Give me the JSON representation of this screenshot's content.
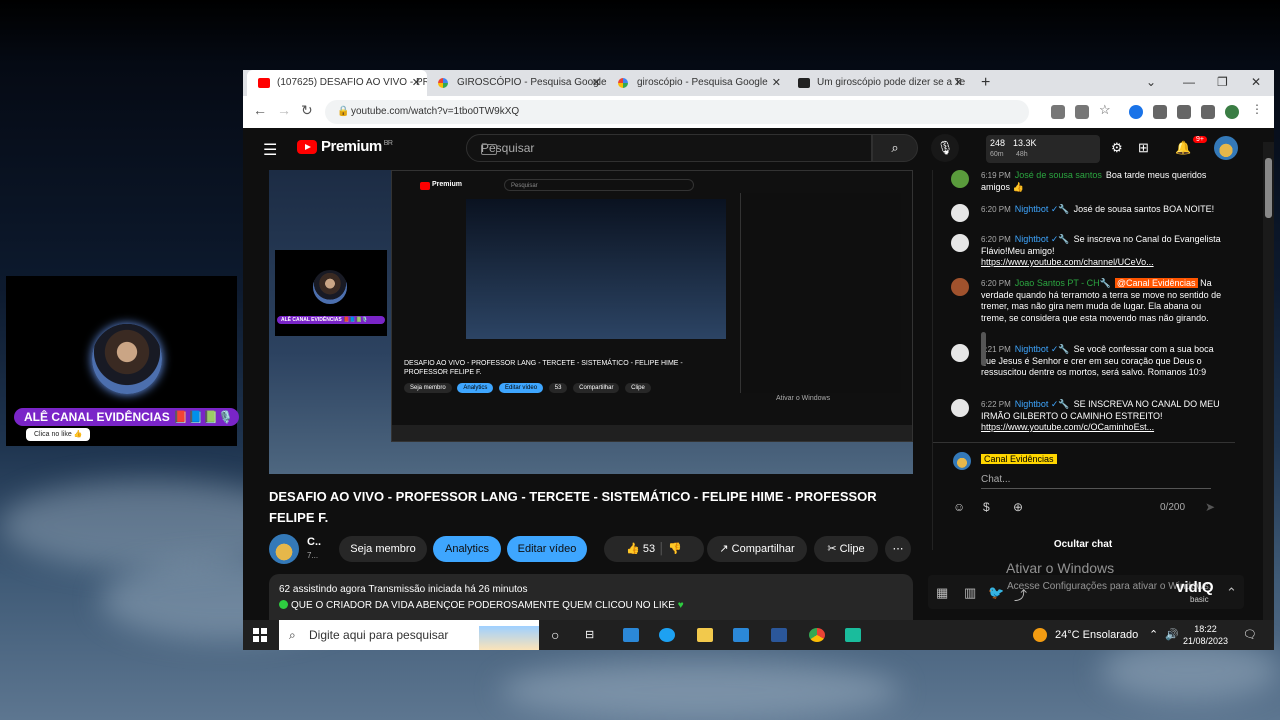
{
  "overlay": {
    "channel_name": "ALÊ CANAL EVIDÊNCIAS 📕📘📗🎙️",
    "tag": "Clica no like 👍"
  },
  "browser": {
    "tabs": [
      {
        "title": "(107625) DESAFIO AO VIVO - PR",
        "favicon": "youtube-icon",
        "active": true
      },
      {
        "title": "GIROSCÓPIO - Pesquisa Google",
        "favicon": "google-icon",
        "active": false
      },
      {
        "title": "giroscópio - Pesquisa Google",
        "favicon": "google-icon",
        "active": false
      },
      {
        "title": "Um giroscópio pode dizer se a Te",
        "favicon": "site-icon",
        "active": false
      }
    ],
    "url": "youtube.com/watch?v=1tbo0TW9kXQ"
  },
  "yt": {
    "logo_text": "Premium",
    "region": "BR",
    "search_placeholder": "Pesquisar",
    "stats": {
      "viewers": "248",
      "subs": "13.3K",
      "viewers_sub": "60m",
      "subs_sub": "48h"
    },
    "notif_badge": "9+"
  },
  "video": {
    "title": "DESAFIO AO VIVO - PROFESSOR LANG - TERCETE - SISTEMÁTICO - FELIPE HIME - PROFESSOR FELIPE F.",
    "channel_short": "C..",
    "channel_sub": "7...",
    "member_btn": "Seja membro",
    "analytics_btn": "Analytics",
    "edit_btn": "Editar vídeo",
    "likes": "53",
    "share_btn": "Compartilhar",
    "clip_btn": "Clipe",
    "desc_line1": "62 assistindo agora  Transmissão iniciada há 26 minutos",
    "desc_line2": "QUE O CRIADOR DA VIDA ABENÇOE PODEROSAMENTE QUEM CLICOU NO LIKE"
  },
  "inner": {
    "title": "DESAFIO AO VIVO - PROFESSOR LANG - TERCETE - SISTEMÁTICO - FELIPE HIME - PROFESSOR FELIPE F.",
    "buttons": [
      "Seja membro",
      "Analytics",
      "Editar vídeo",
      "53",
      "Compartilhar",
      "Clipe"
    ],
    "activate": "Ativar o Windows"
  },
  "chat": {
    "messages": [
      {
        "time": "6:19 PM",
        "author": "José de sousa santos",
        "bot": false,
        "text": "Boa tarde meus queridos amigos 👍",
        "link": ""
      },
      {
        "time": "6:20 PM",
        "author": "Nightbot ✓🔧",
        "bot": true,
        "text": "José de sousa santos BOA NOITE!",
        "link": ""
      },
      {
        "time": "6:20 PM",
        "author": "Nightbot ✓🔧",
        "bot": true,
        "text": "Se inscreva no Canal do Evangelista Flávio!Meu amigo!",
        "link": "https://www.youtube.com/channel/UCeVo..."
      },
      {
        "time": "6:20 PM",
        "author": "Joao Santos PT - CH🔧",
        "bot": false,
        "tag": "@Canal Evidências",
        "text": "Na verdade quando há terramoto a terra se move no sentido de tremer, mas não gira nem muda de lugar. Ela abana ou treme, se considera que esta movendo mas não girando.",
        "link": ""
      },
      {
        "time": "6:21 PM",
        "author": "Nightbot ✓🔧",
        "bot": true,
        "text": "Se você confessar com a sua boca que Jesus é Senhor e crer em seu coração que Deus o ressuscitou dentre os mortos, será salvo. Romanos 10:9",
        "link": ""
      },
      {
        "time": "6:22 PM",
        "author": "Nightbot ✓🔧",
        "bot": true,
        "text": "SE INSCREVA NO CANAL DO MEU IRMÃO GILBERTO O CAMINHO ESTREITO!",
        "link": "https://www.youtube.com/c/OCaminhoEst..."
      }
    ],
    "input_name": "Canal Evidências",
    "input_placeholder": "Chat...",
    "counter": "0/200",
    "hide_label": "Ocultar chat"
  },
  "watermark": {
    "line1": "Ativar o Windows",
    "line2": "Acesse Configurações para ativar o Windows."
  },
  "vidiq": {
    "label": "vidIQ",
    "plan": "basic"
  },
  "taskbar": {
    "search_placeholder": "Digite aqui para pesquisar",
    "weather": "24°C  Ensolarado",
    "time": "18:22",
    "date": "21/08/2023"
  },
  "colors": {
    "accent_blue": "#3ea6ff",
    "yt_red": "#ff0000",
    "owner_orange": "#ff5500",
    "member_yellow": "#ffd600",
    "overlay_purple": "#7a25c8"
  }
}
